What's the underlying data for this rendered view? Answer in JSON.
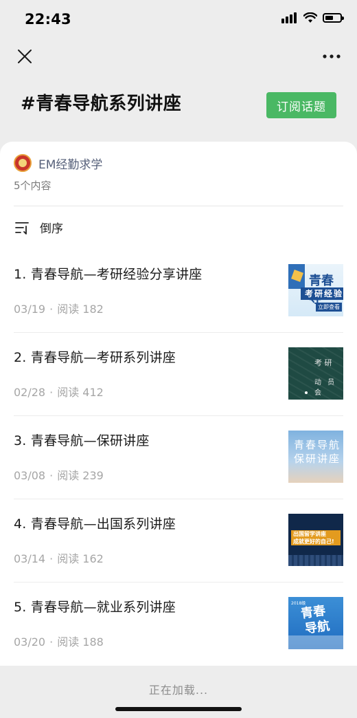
{
  "status_bar": {
    "time": "22:43"
  },
  "header": {
    "title": "#青春导航系列讲座",
    "subscribe_label": "订阅话题"
  },
  "account": {
    "name": "EM经勤求学",
    "content_count": "5个内容"
  },
  "sort": {
    "label": "倒序"
  },
  "articles": [
    {
      "title": "1. 青春导航—考研经验分享讲座",
      "date": "03/19",
      "separator": "·",
      "reads": "阅读 182",
      "thumb_text": [
        "青春导",
        "考研经验",
        "立即查看"
      ]
    },
    {
      "title": "2. 青春导航—考研系列讲座",
      "date": "02/28",
      "separator": "·",
      "reads": "阅读 412",
      "thumb_text": [
        "考 研",
        "动 员 会"
      ]
    },
    {
      "title": "3. 青春导航—保研讲座",
      "date": "03/08",
      "separator": "·",
      "reads": "阅读 239",
      "thumb_text": [
        "青春导航",
        "保研讲座"
      ]
    },
    {
      "title": "4. 青春导航—出国系列讲座",
      "date": "03/14",
      "separator": "·",
      "reads": "阅读 162",
      "thumb_text": [
        "出国留学讲座",
        "成就更好的自己!"
      ]
    },
    {
      "title": "5. 青春导航—就业系列讲座",
      "date": "03/20",
      "separator": "·",
      "reads": "阅读 188",
      "thumb_text": [
        "青春",
        "导航",
        "2018级"
      ]
    }
  ],
  "footer": {
    "loading": "正在加载..."
  },
  "colors": {
    "accent_green": "#4ab864",
    "page_background": "#ededed",
    "account_name": "#56607a"
  },
  "icons": [
    "close-icon",
    "more-icon",
    "sort-icon",
    "signal-icon",
    "wifi-icon",
    "battery-icon"
  ]
}
